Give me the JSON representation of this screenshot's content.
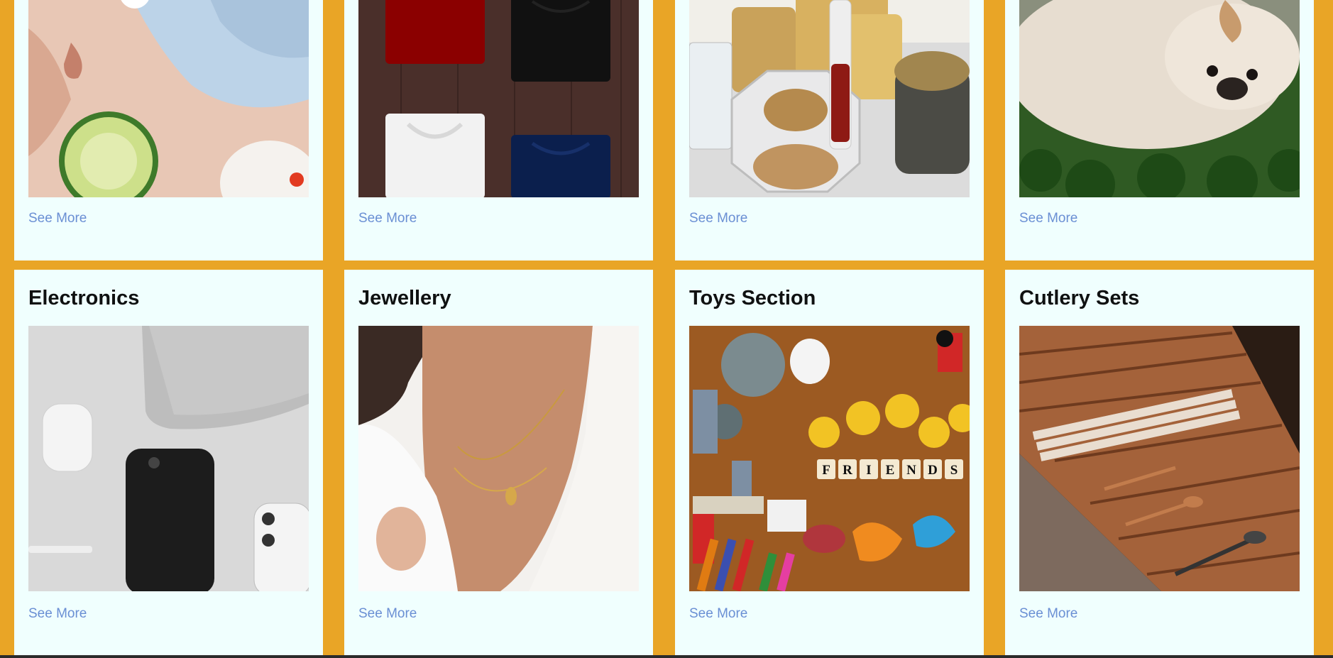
{
  "colors": {
    "page_bg": "#e9a526",
    "card_bg": "#f0fffe",
    "link": "#6a8fd4"
  },
  "top_row": [
    {
      "image": "spa-face-cucumber",
      "link": "See More"
    },
    {
      "image": "folded-tshirts",
      "link": "See More"
    },
    {
      "image": "cosmetics-products",
      "link": "See More"
    },
    {
      "image": "puppy-on-grass",
      "link": "See More"
    }
  ],
  "bottom_row": [
    {
      "title": "Electronics",
      "image": "phone-airpods-laptop",
      "link": "See More"
    },
    {
      "title": "Jewellery",
      "image": "woman-necklace",
      "link": "See More"
    },
    {
      "title": "Toys Section",
      "image": "toys-friends-tiles",
      "link": "See More"
    },
    {
      "title": "Cutlery Sets",
      "image": "cutlery-drawer",
      "link": "See More"
    }
  ],
  "friends_tiles": [
    "F",
    "R",
    "I",
    "E",
    "N",
    "D",
    "S"
  ]
}
